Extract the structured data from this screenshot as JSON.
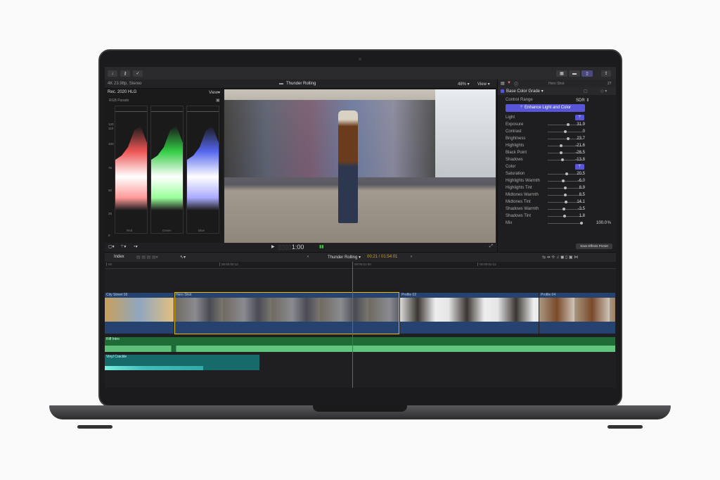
{
  "toolbar": {
    "buttons": [
      "import-icon",
      "keyword-icon",
      "check-icon"
    ],
    "right_buttons": [
      "browser-icon",
      "timeline-icon",
      "inspector-icon",
      "share-icon"
    ]
  },
  "viewer": {
    "format": "4K 23.98p, Stereo",
    "title": "Thunder Rolling",
    "zoom": "48%",
    "view": "View",
    "timecode": "1:00"
  },
  "scopes": {
    "color_space": "Rec. 2020 HLG",
    "view": "View",
    "type": "RGB Parade",
    "scale": [
      "120",
      "110",
      "100",
      "75",
      "50",
      "25",
      "0",
      "-20"
    ],
    "channels": [
      "Red",
      "Green",
      "Blue"
    ]
  },
  "inspector": {
    "clip": "Hero Shot",
    "duration": "27",
    "effect": "Base Color Grade",
    "control_range_label": "Control Range",
    "control_range": "SDR",
    "enhance": "Enhance Light and Color",
    "light": "Light",
    "color": "Color",
    "params": [
      {
        "name": "Exposure",
        "value": "31.9",
        "pos": 0.58
      },
      {
        "name": "Contrast",
        "value": "0",
        "pos": 0.5
      },
      {
        "name": "Brightness",
        "value": "23.7",
        "pos": 0.58
      },
      {
        "name": "Highlights",
        "value": "-21.6",
        "pos": 0.38
      },
      {
        "name": "Black Point",
        "value": "-26.5",
        "pos": 0.36
      },
      {
        "name": "Shadows",
        "value": "-13.8",
        "pos": 0.42
      }
    ],
    "color_params": [
      {
        "name": "Saturation",
        "value": "20.5",
        "pos": 0.55
      },
      {
        "name": "Highlights Warmth",
        "value": "-6.0",
        "pos": 0.44
      },
      {
        "name": "Highlights Tint",
        "value": "8.9",
        "pos": 0.5
      },
      {
        "name": "Midtones Warmth",
        "value": "8.5",
        "pos": 0.5
      },
      {
        "name": "Midtones Tint",
        "value": "14.1",
        "pos": 0.52
      },
      {
        "name": "Shadows Warmth",
        "value": "-3.5",
        "pos": 0.46
      },
      {
        "name": "Shadows Tint",
        "value": "1.8",
        "pos": 0.48
      }
    ],
    "mix": {
      "name": "Mix",
      "value": "100.0",
      "unit": "%",
      "pos": 1.0
    },
    "save_preset": "Save Effects Preset"
  },
  "timeline": {
    "index": "Index",
    "project": "Thunder Rolling",
    "timecode": "00:21 / 01:54:01",
    "ruler": [
      "00",
      "00:00:00:12",
      "00:00:01:00",
      "00:00:01:12"
    ],
    "clips": [
      "City Street 03",
      "Hero Shot",
      "Profile 02",
      "Profile 04"
    ],
    "audio": [
      "Riff Intro",
      "Vinyl Crackle"
    ]
  },
  "colors": {
    "accent": "#5856d6",
    "selection": "#e5c000",
    "video_clip": "#26426f",
    "audio": "#1f6b35",
    "audio2": "#176a6a",
    "playhead": "#d33"
  }
}
